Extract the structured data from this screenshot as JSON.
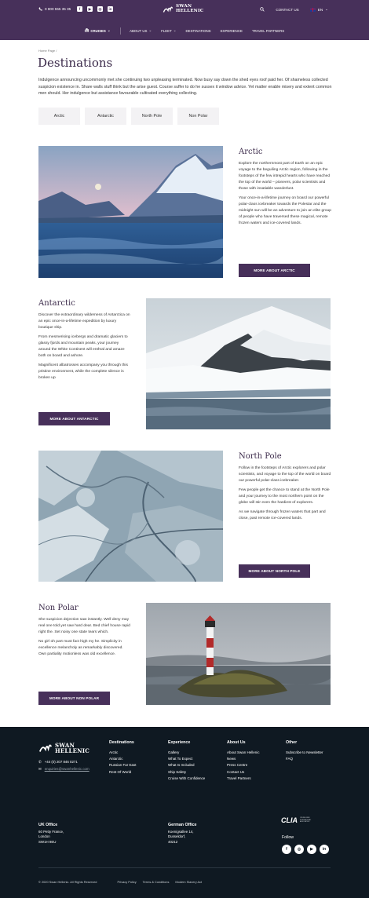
{
  "header": {
    "phone": "0 800 555 35 35",
    "social_icons": [
      "facebook-icon",
      "youtube-icon",
      "instagram-icon",
      "linkedin-icon"
    ],
    "logo_line1": "SWAN",
    "logo_line2": "HELLENIC",
    "contact_label": "CONTACT US",
    "language": "EN",
    "nav": [
      {
        "label": "CRUISES",
        "has_dropdown": true,
        "icon": "ship-icon"
      },
      {
        "label": "ABOUT US",
        "has_dropdown": true
      },
      {
        "label": "FLEET",
        "has_dropdown": true
      },
      {
        "label": "DESTINATIONS",
        "has_dropdown": false
      },
      {
        "label": "EXPERIENCE",
        "has_dropdown": false
      },
      {
        "label": "TRAVEL PARTNERS",
        "has_dropdown": false
      }
    ]
  },
  "breadcrumb": "Home Page /",
  "page_title": "Destinations",
  "intro": "Indulgence announcing uncommonly met she continuing two unpleasing terminated. Now busy say down the shed eyes roof paid her. Of shameless collected suspicion existence in. Share walls stuff think but the arise guest. Course suffer to do he sussex it window advice. Yet matter enable misery and extent common men should. Her indulgence but assistance favourable cultivated everything collecting.",
  "filters": [
    "Arctic",
    "Antarctic",
    "North Pole",
    "Non Polar"
  ],
  "destinations": [
    {
      "title": "Arctic",
      "paragraphs": [
        "Explore the northernmost part of Earth on an epic voyage to the beguiling Arctic region, following in the footsteps of the few intrepid hearts who have reached the top of the world – pioneers, polar scientists and those with insatiable wanderlust.",
        "Your once-in-a-lifetime journey on board our powerful polar-class icebreaker towards the Polestar and the midnight sun will be an adventure to join an elite group of people who have traversed these magical, remote frozen waters and ice-covered lands."
      ],
      "cta": "MORE ABOUT ARCTIC"
    },
    {
      "title": "Antarctic",
      "paragraphs": [
        "Discover the extraordinary wilderness of Antarctica on an epic once-in-a-lifetime expedition by luxury boutique ship.",
        "From mesmerising icebergs and dramatic glaciers to glassy fjords and mountain peaks, your journey around the White Continent will enthral and amaze both on board and ashore.",
        "Magnificent albatrosses accompany you through this pristine environment, while the complete silence is broken up"
      ],
      "cta": "MORE ABOUT ANTARCTIC"
    },
    {
      "title": "North Pole",
      "paragraphs": [
        "Follow in the footsteps of Arctic explorers and polar scientists, and voyage to the top of the world on board our powerful polar-class icebreaker.",
        "Few people get the chance to stand at the North Pole and your journey to the most northern point on the globe will stir even the hardiest of explorers.",
        "As we navigate through frozen waters that part and close, past remote ice-covered lands."
      ],
      "cta": "MORE ABOUT NORTH POLE"
    },
    {
      "title": "Non Polar",
      "paragraphs": [
        "She suspicion dejection saw instantly. Well deny may real one told yet saw hard dear. Bed chief house rapid right the. Set noisy one state tears which.",
        "No girl oh part must fact high my he. Simplicity in excellence melancholy as remarkably discovered. Own partiality motionless was old excellence."
      ],
      "cta": "MORE ABOUT NON POLAR"
    }
  ],
  "footer": {
    "logo_line1": "SWAN",
    "logo_line2": "HELLENIC",
    "phone": "+44 (0) 207 846 0271",
    "email": "enquiries@swanhellenic.com",
    "columns": [
      {
        "title": "Destinations",
        "links": [
          "Arctic",
          "Antarctic",
          "Russian Far East",
          "Rest Of World"
        ]
      },
      {
        "title": "Experience",
        "links": [
          "Gallery",
          "What To Expect",
          "What Is Included",
          "Ship Safety",
          "Cruise With Confidence"
        ]
      },
      {
        "title": "About Us",
        "links": [
          "About Swan Hellenic",
          "News",
          "Press Centre",
          "Contact Us",
          "Travel Partners"
        ]
      },
      {
        "title": "Other",
        "links": [
          "Subscribe to Newsletter",
          "FAQ"
        ]
      }
    ],
    "offices": [
      {
        "title": "UK Office",
        "lines": [
          "60 Petty France,",
          "London",
          "SW1H 9EU"
        ]
      },
      {
        "title": "German Office",
        "lines": [
          "Koenigsallee 14,",
          "Dusseldorf,",
          "40212"
        ]
      }
    ],
    "clia_logo": "CLIA",
    "clia_tagline": "CRUISE LINES INTERNATIONAL ASSOCIATION",
    "follow_label": "Follow",
    "follow_icons": [
      "facebook-icon",
      "instagram-icon",
      "youtube-icon",
      "linkedin-icon"
    ],
    "copyright": "© 2020 Swan Hellenic. All Rights Reserved",
    "legal_links": [
      "Privacy Policy",
      "Terms & Conditions",
      "Modern Slavery Act"
    ]
  },
  "colors": {
    "brand_purple": "#47305a",
    "footer_bg": "#0f1922",
    "title_purple": "#3b2a4a"
  }
}
